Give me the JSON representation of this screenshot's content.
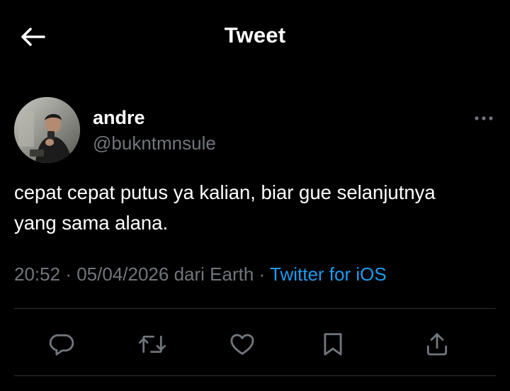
{
  "header": {
    "title": "Tweet",
    "back_icon": "arrow-left-icon"
  },
  "author": {
    "name": "andre",
    "handle": "@bukntmnsule",
    "avatar_icon": "profile-photo",
    "more_icon": "more-horizontal-icon"
  },
  "tweet": {
    "text_line_1": "cepat cepat putus ya kalian, biar gue selanjutnya",
    "text_line_2": "yang sama alana."
  },
  "meta": {
    "time": "20:52",
    "separator_1": "·",
    "date": "05/04/2026",
    "location": "dari Earth",
    "separator_2": "·",
    "source": "Twitter for iOS"
  },
  "actions": [
    {
      "name": "reply",
      "icon": "reply-icon"
    },
    {
      "name": "retweet",
      "icon": "retweet-icon"
    },
    {
      "name": "like",
      "icon": "heart-icon"
    },
    {
      "name": "bookmark",
      "icon": "bookmark-icon"
    },
    {
      "name": "share",
      "icon": "share-icon"
    }
  ],
  "colors": {
    "background": "#000000",
    "text": "#ffffff",
    "secondary": "#71767b",
    "accent": "#1d9bf0",
    "divider": "#2f3336"
  }
}
